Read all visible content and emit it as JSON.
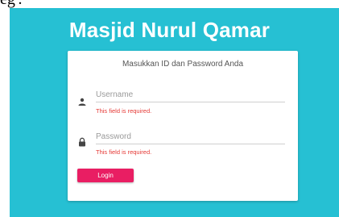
{
  "page": {
    "top_fragment": "eg'."
  },
  "header": {
    "title": "Masjid Nurul Qamar"
  },
  "login_card": {
    "heading": "Masukkan ID dan Password Anda",
    "username": {
      "placeholder": "Username",
      "value": "",
      "error": "This field is required.",
      "icon": "person-icon"
    },
    "password": {
      "placeholder": "Password",
      "value": "",
      "error": "This field is required.",
      "icon": "lock-icon"
    },
    "login_label": "Login"
  },
  "colors": {
    "background": "#26c0d3",
    "button": "#e91e63",
    "error": "#e53935"
  }
}
